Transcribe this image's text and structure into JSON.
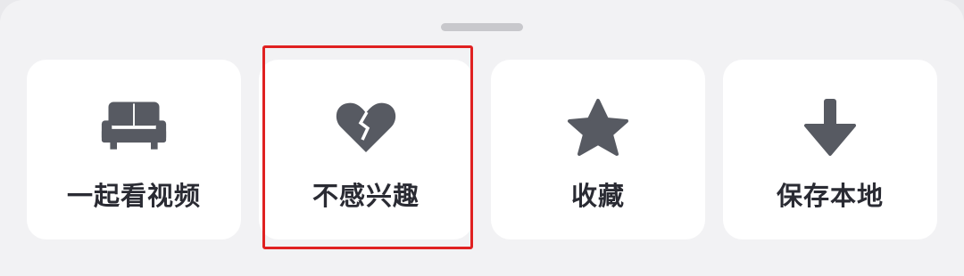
{
  "sheet": {
    "actions": [
      {
        "label": "一起看视频",
        "icon": "sofa-icon"
      },
      {
        "label": "不感兴趣",
        "icon": "broken-heart-icon"
      },
      {
        "label": "收藏",
        "icon": "star-icon"
      },
      {
        "label": "保存本地",
        "icon": "download-arrow-icon"
      }
    ],
    "highlighted_action": "不感兴趣"
  },
  "colors": {
    "icon": "#575a62",
    "label": "#2a2b33",
    "tile_background": "#ffffff",
    "sheet_background": "#f2f2f4",
    "highlight_border": "#e02121"
  }
}
